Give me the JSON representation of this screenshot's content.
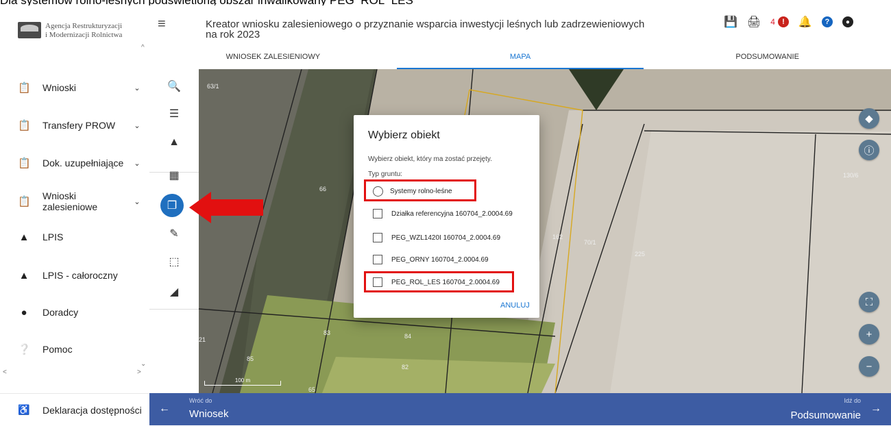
{
  "caption": "Dla systemów rolno-leśnych podświetloną obszar inwalikowany PEG_ROL_LES",
  "sidebar": {
    "logo_line1": "Agencja Restrukturyzacji",
    "logo_line2": "i Modernizacji Rolnictwa",
    "items": [
      {
        "label": "Wnioski",
        "icon": "clipboard-icon",
        "has_chevron": true
      },
      {
        "label": "Transfery PROW",
        "icon": "clipboard-icon",
        "has_chevron": true
      },
      {
        "label": "Dok. uzupełniające",
        "icon": "clipboard-icon",
        "has_chevron": true
      },
      {
        "label": "Wnioski zalesieniowe",
        "icon": "clipboard-icon",
        "has_chevron": true
      },
      {
        "label": "LPIS",
        "icon": "terrain-icon",
        "has_chevron": false
      },
      {
        "label": "LPIS - całoroczny",
        "icon": "terrain-icon",
        "has_chevron": false
      },
      {
        "label": "Doradcy",
        "icon": "person-icon",
        "has_chevron": false
      },
      {
        "label": "Pomoc",
        "icon": "help-icon",
        "has_chevron": false
      }
    ],
    "declaration": "Deklaracja dostępności"
  },
  "header": {
    "title_line1": "Kreator wniosku zalesieniowego o przyznanie wsparcia inwestycji leśnych lub zadrzewieniowych",
    "title_line2": "na rok 2023",
    "alert_count": "4",
    "alert_symbol": "!",
    "help_symbol": "?"
  },
  "tabs": [
    {
      "label": "WNIOSEK ZALESIENIOWY",
      "active": false
    },
    {
      "label": "MAPA",
      "active": true
    },
    {
      "label": "PODSUMOWANIE",
      "active": false
    }
  ],
  "map": {
    "parcel_labels": [
      "63/1",
      "66",
      "162",
      "70/1",
      "225",
      "83",
      "84",
      "82",
      "85",
      "21",
      "65",
      "130/6"
    ],
    "scale": "100 m"
  },
  "dialog": {
    "title": "Wybierz obiekt",
    "subtitle": "Wybierz obiekt, który ma zostać przejęty.",
    "type_label": "Typ gruntu:",
    "options": [
      {
        "label": "Systemy rolno-leśne",
        "kind": "radio",
        "highlighted": true
      },
      {
        "label": "Działka referencyjna 160704_2.0004.69",
        "kind": "checkbox",
        "highlighted": false
      },
      {
        "label": "PEG_WZL1420I 160704_2.0004.69",
        "kind": "checkbox",
        "highlighted": false
      },
      {
        "label": "PEG_ORNY 160704_2.0004.69",
        "kind": "checkbox",
        "highlighted": false
      },
      {
        "label": "PEG_ROL_LES 160704_2.0004.69",
        "kind": "checkbox",
        "highlighted": true
      }
    ],
    "cancel": "ANULUJ"
  },
  "bottom": {
    "back_small": "Wróć do",
    "back": "Wniosek",
    "next_small": "Idź do",
    "next": "Podsumowanie"
  },
  "colors": {
    "highlight": "#e21010",
    "accent": "#1976d2",
    "bottom_bar": "#3d5ca3",
    "active_tool": "#1f6fbf"
  }
}
